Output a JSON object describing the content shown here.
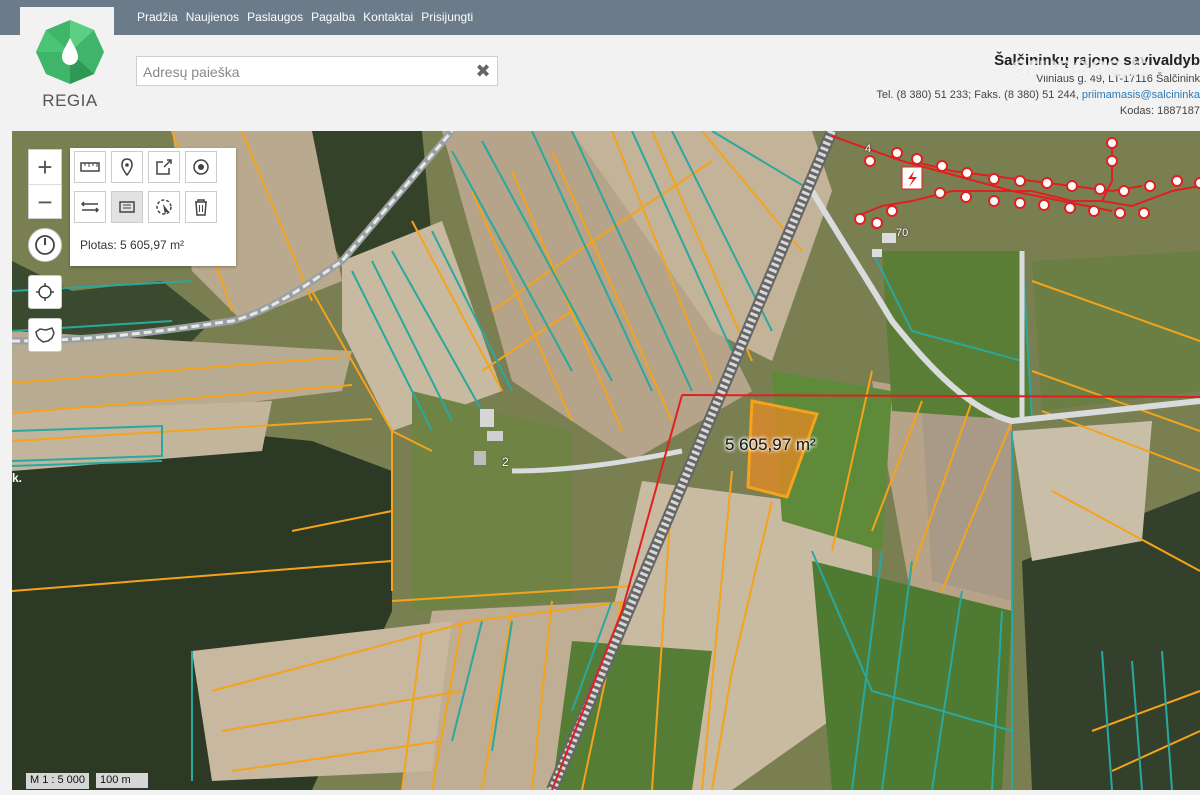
{
  "nav": {
    "links": [
      "Pradžia",
      "Naujienos",
      "Paslaugos",
      "Pagalba",
      "Kontaktai",
      "Prisijungti"
    ]
  },
  "logo": {
    "text": "REGIA"
  },
  "search": {
    "placeholder": "Adresų paieška",
    "clear_glyph": "✖"
  },
  "org": {
    "name": "Šalčininkų rajono savivaldyb",
    "address": "Vilniaus g. 49, LT-17116 Šalčinink",
    "phone": "Tel. (8 380) 51 233; Faks. (8 380) 51 244, ",
    "email": "priimamasis@salcininka",
    "code": "Kodas: 1887187"
  },
  "watermark": "aruodas.lt",
  "map": {
    "area_readout": "Plotas: 5 605,97 m²",
    "measure_label": "5 605,97 m²",
    "scale_ratio": "M 1 : 5 000",
    "scale_bar": "100 m",
    "parcel_numbers": [
      "2",
      "70",
      "4"
    ],
    "edge_label": "k.",
    "controls": {
      "zoom_in": "+",
      "zoom_out": "−"
    },
    "colors": {
      "parcel_orange": "#f5a31a",
      "parcel_teal": "#2aa8a0",
      "measure_red": "#e02020",
      "selection_fill": "#f08a24",
      "road_gray": "#cfd4d6"
    },
    "icons": [
      "ruler-icon",
      "marker-icon",
      "export-icon",
      "target-icon",
      "distance-icon",
      "area-icon",
      "cursor-area-icon",
      "trash-icon",
      "power-icon",
      "locate-icon",
      "lithuania-icon"
    ]
  }
}
